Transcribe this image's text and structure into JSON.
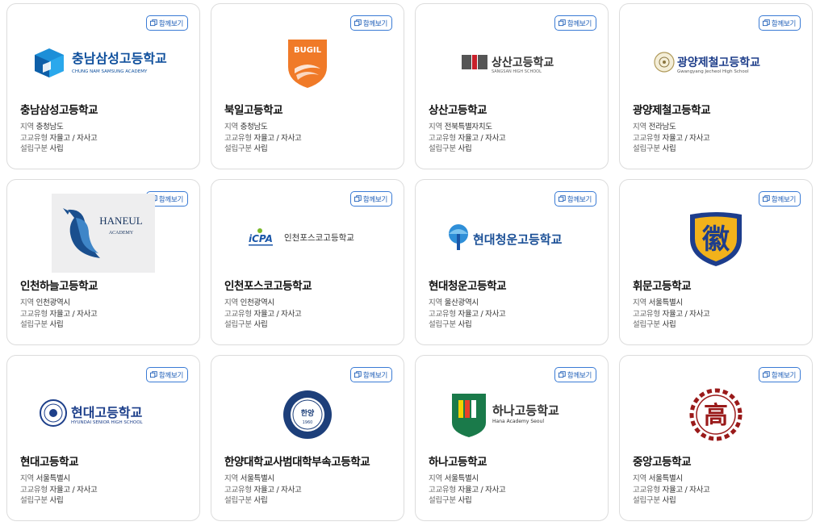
{
  "compare_label": "함께보기",
  "labels": {
    "region": "지역",
    "type": "고교유형",
    "founding": "설립구분"
  },
  "schools": [
    {
      "name": "충남삼성고등학교",
      "region": "충청남도",
      "type": "자율고 / 자사고",
      "founding": "사립",
      "logo_text": "충남삼성고등학교",
      "logo_sub": "CHUNG NAM SAMSUNG ACADEMY"
    },
    {
      "name": "북일고등학교",
      "region": "충청남도",
      "type": "자율고 / 자사고",
      "founding": "사립",
      "logo_text": "BUGIL",
      "logo_sub": ""
    },
    {
      "name": "상산고등학교",
      "region": "전북특별자치도",
      "type": "자율고 / 자사고",
      "founding": "사립",
      "logo_text": "상산고등학교",
      "logo_sub": "SANGSAN HIGH SCHOOL"
    },
    {
      "name": "광양제철고등학교",
      "region": "전라남도",
      "type": "자율고 / 자사고",
      "founding": "사립",
      "logo_text": "광양제철고등학교",
      "logo_sub": "Gwangyang Jecheol High School"
    },
    {
      "name": "인천하늘고등학교",
      "region": "인천광역시",
      "type": "자율고 / 자사고",
      "founding": "사립",
      "logo_text": "HANEUL",
      "logo_sub": "ACADEMY"
    },
    {
      "name": "인천포스코고등학교",
      "region": "인천광역시",
      "type": "자율고 / 자사고",
      "founding": "사립",
      "logo_text": "인천포스코고등학교",
      "logo_sub": "iCPA"
    },
    {
      "name": "현대청운고등학교",
      "region": "울산광역시",
      "type": "자율고 / 자사고",
      "founding": "사립",
      "logo_text": "현대청운고등학교",
      "logo_sub": ""
    },
    {
      "name": "휘문고등학교",
      "region": "서울특별시",
      "type": "자율고 / 자사고",
      "founding": "사립",
      "logo_text": "徽",
      "logo_sub": ""
    },
    {
      "name": "현대고등학교",
      "region": "서울특별시",
      "type": "자율고 / 자사고",
      "founding": "사립",
      "logo_text": "현대고등학교",
      "logo_sub": "HYUNDAI SENIOR HIGH SCHOOL"
    },
    {
      "name": "한양대학교사범대학부속고등학교",
      "region": "서울특별시",
      "type": "자율고 / 자사고",
      "founding": "사립",
      "logo_text": "한양",
      "logo_sub": "1960"
    },
    {
      "name": "하나고등학교",
      "region": "서울특별시",
      "type": "자율고 / 자사고",
      "founding": "사립",
      "logo_text": "하나고등학교",
      "logo_sub": "Hana Academy Seoul"
    },
    {
      "name": "중앙고등학교",
      "region": "서울특별시",
      "type": "자율고 / 자사고",
      "founding": "사립",
      "logo_text": "高",
      "logo_sub": ""
    }
  ],
  "colors": {
    "accent": "#1f5fb8",
    "border": "#dcdcdc"
  }
}
